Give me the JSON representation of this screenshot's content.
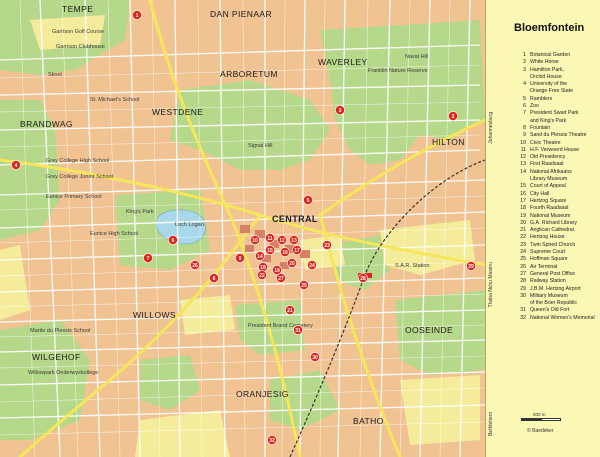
{
  "map": {
    "title": "Bloemfontein",
    "districts": [
      {
        "id": "tempe",
        "label": "TEMPE"
      },
      {
        "id": "dan-pienaar",
        "label": "DAN PIENAAR"
      },
      {
        "id": "arboretum",
        "label": "ARBORETUM"
      },
      {
        "id": "waverley",
        "label": "WAVERLEY"
      },
      {
        "id": "brandwag",
        "label": "BRANDWAG"
      },
      {
        "id": "westdene",
        "label": "WESTDENE"
      },
      {
        "id": "hilton",
        "label": "HILTON"
      },
      {
        "id": "central",
        "label": "CENTRAL"
      },
      {
        "id": "willows",
        "label": "WILLOWS"
      },
      {
        "id": "oranjesig",
        "label": "ORANJESIG"
      },
      {
        "id": "oosseinde",
        "label": "OOSEINDE"
      },
      {
        "id": "wilgehof",
        "label": "WILGEHOF"
      },
      {
        "id": "batho",
        "label": "BATHO"
      }
    ],
    "places": [
      {
        "id": "garrison-golf",
        "label": "Garrison Golf Course"
      },
      {
        "id": "garrison-clubhouse",
        "label": "Garrison Clubhouse"
      },
      {
        "id": "skool",
        "label": "Skool"
      },
      {
        "id": "st-michaels",
        "label": "St. Michael's School"
      },
      {
        "id": "naval-hill",
        "label": "Naval Hill"
      },
      {
        "id": "franklin-reserve",
        "label": "Franklin Nature Reserve"
      },
      {
        "id": "signal-hill",
        "label": "Signal Hill"
      },
      {
        "id": "kings-park",
        "label": "King's Park"
      },
      {
        "id": "loch-logan",
        "label": "Loch Logan"
      },
      {
        "id": "grey-college-high",
        "label": "Grey College High School"
      },
      {
        "id": "grey-college-junior",
        "label": "Grey College Junior School"
      },
      {
        "id": "eunice-primary",
        "label": "Eunice Primary School"
      },
      {
        "id": "eunice-high",
        "label": "Eunice High School"
      },
      {
        "id": "lourdes",
        "label": "Martie du Plessis School"
      },
      {
        "id": "president-brand",
        "label": "President Brand Cemetery"
      },
      {
        "id": "willowpark",
        "label": "Willowpark Onderwyskollege"
      },
      {
        "id": "sar-station",
        "label": "S.A.R. Station"
      }
    ],
    "edge_labels": {
      "right_top": "Johannesburg",
      "right_mid": "Thaba Nchu Maseru",
      "right_bottom": "Bethlehem"
    },
    "markers": [
      "1",
      "2",
      "3",
      "4",
      "5",
      "6",
      "7",
      "8",
      "9",
      "10",
      "11",
      "12",
      "13",
      "14",
      "15",
      "16",
      "17",
      "18",
      "19",
      "20",
      "21",
      "22",
      "23",
      "24",
      "25",
      "26",
      "27",
      "28",
      "29",
      "30",
      "31",
      "32"
    ]
  },
  "legend": {
    "title": "Bloemfontein",
    "items": [
      {
        "n": "1",
        "t": "Botanical Garden"
      },
      {
        "n": "2",
        "t": "White Horse"
      },
      {
        "n": "3",
        "t": "Hamilton Park,",
        "c": "Orchid House"
      },
      {
        "n": "4",
        "t": "University of the",
        "c": "Orange Free State"
      },
      {
        "n": "5",
        "t": "Ramblers"
      },
      {
        "n": "6",
        "t": "Zoo"
      },
      {
        "n": "7",
        "t": "President Swart Park",
        "c": "and King's Park"
      },
      {
        "n": "8",
        "t": "Fountain"
      },
      {
        "n": "9",
        "t": "Sand du Plessis Theatre"
      },
      {
        "n": "10",
        "t": "Civic Theatre"
      },
      {
        "n": "11",
        "t": "H.F. Verwoerd House"
      },
      {
        "n": "12",
        "t": "Old Presidency"
      },
      {
        "n": "13",
        "t": "First Raadsaal"
      },
      {
        "n": "14",
        "t": "National Afrikaans",
        "c": "Library Museum"
      },
      {
        "n": "15",
        "t": "Court of Appeal"
      },
      {
        "n": "16",
        "t": "City Hall"
      },
      {
        "n": "17",
        "t": "Hertzog Square"
      },
      {
        "n": "18",
        "t": "Fourth Raadsaal"
      },
      {
        "n": "19",
        "t": "National Museum"
      },
      {
        "n": "20",
        "t": "G.A. Richard Library"
      },
      {
        "n": "21",
        "t": "Anglican Cathedral"
      },
      {
        "n": "22",
        "t": "Hertzog House"
      },
      {
        "n": "23",
        "t": "Twin Spired Church"
      },
      {
        "n": "24",
        "t": "Supreme Court"
      },
      {
        "n": "25",
        "t": "Hoffman Square"
      },
      {
        "n": "26",
        "t": "Air Terminal"
      },
      {
        "n": "27",
        "t": "General Post Office"
      },
      {
        "n": "28",
        "t": "Railway Station"
      },
      {
        "n": "29",
        "t": "J.B.M. Hertzog Airport"
      },
      {
        "n": "30",
        "t": "Military Museum",
        "c": "of the Boer Republic"
      },
      {
        "n": "31",
        "t": "Queen's Old Fort"
      },
      {
        "n": "32",
        "t": "National Women's Memorial"
      }
    ],
    "scale_label": "500 m",
    "credit": "© Baedeker"
  }
}
